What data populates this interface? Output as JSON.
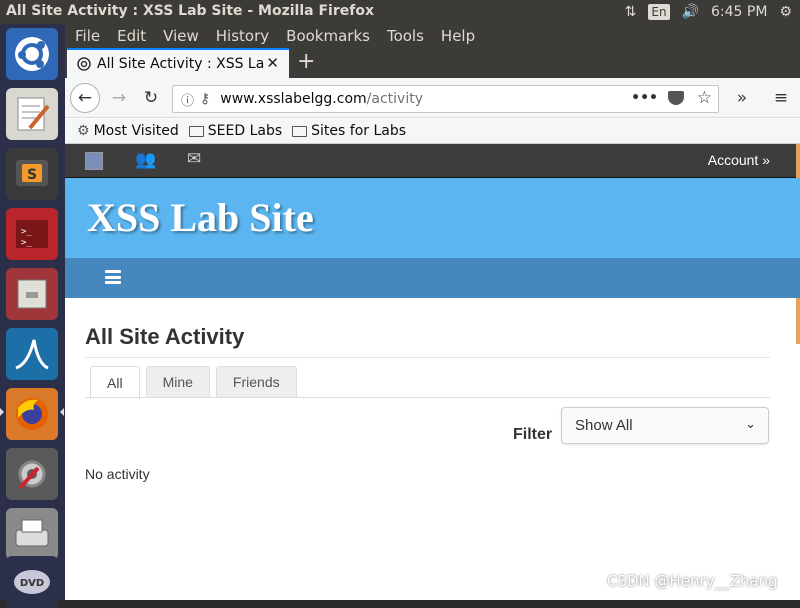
{
  "top_panel": {
    "window_title": "All Site Activity : XSS Lab Site - Mozilla Firefox",
    "keyboard_lang": "En",
    "clock": "6:45 PM"
  },
  "launcher": {
    "items": [
      "ubuntu-dash-icon",
      "text-editor-icon",
      "sublime-text-icon",
      "terminal-icon",
      "file-cabinet-icon",
      "wireshark-icon",
      "firefox-icon",
      "system-settings-icon",
      "scanner-icon",
      "dvd-icon"
    ]
  },
  "browser": {
    "menu": [
      "File",
      "Edit",
      "View",
      "History",
      "Bookmarks",
      "Tools",
      "Help"
    ],
    "tab_title": "All Site Activity : XSS Lab Site",
    "url_host": "www.xsslabelgg.com",
    "url_path": "/activity",
    "bookmarks": [
      "Most Visited",
      "SEED Labs",
      "Sites for Labs"
    ]
  },
  "page": {
    "account_label": "Account »",
    "site_title": "XSS Lab Site",
    "heading": "All Site Activity",
    "tabs": [
      "All",
      "Mine",
      "Friends"
    ],
    "active_tab": "All",
    "filter_label": "Filter",
    "filter_value": "Show All",
    "empty_message": "No activity"
  },
  "watermark": "CSDN @Henry__Zhang",
  "colors": {
    "site_header": "#5bb5f0",
    "site_nav": "#4688bd",
    "topbar": "#3d3d3d",
    "launcher_bg": "#2c2f4a"
  }
}
